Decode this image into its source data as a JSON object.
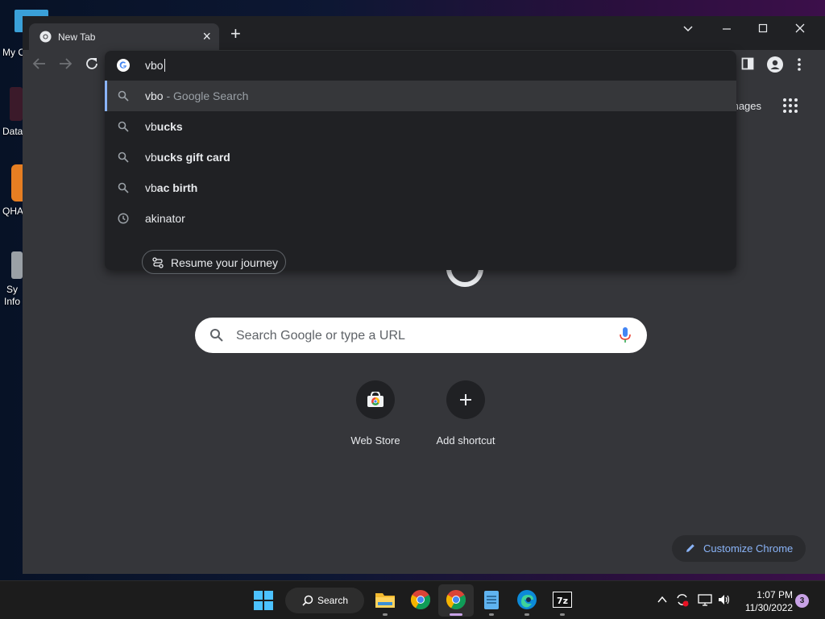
{
  "desktop": {
    "icons": [
      {
        "label": "My C",
        "color": "#3aa0d8"
      },
      {
        "label": "Data",
        "color": "#c0392b"
      },
      {
        "label": "QHA",
        "color": "#e67e22"
      },
      {
        "label": "Sy\nInfo",
        "color": "#9aa0a6"
      }
    ]
  },
  "tab": {
    "title": "New Tab"
  },
  "omnibox": {
    "value": "vbo",
    "suggestions": [
      {
        "prefix": "vbo",
        "bold": "",
        "suffix": " - Google Search",
        "icon": "search-icon"
      },
      {
        "prefix": "vb",
        "bold": "ucks",
        "suffix": "",
        "icon": "search-icon"
      },
      {
        "prefix": "vb",
        "bold": "ucks gift card",
        "suffix": "",
        "icon": "search-icon"
      },
      {
        "prefix": "vb",
        "bold": "ac birth",
        "suffix": "",
        "icon": "search-icon"
      },
      {
        "prefix": "akinator",
        "bold": "",
        "suffix": "",
        "icon": "history-icon"
      }
    ],
    "journey_chip": "Resume your journey"
  },
  "ntp": {
    "images_link": "mages",
    "search_placeholder": "Search Google or type a URL",
    "shortcuts": [
      {
        "label": "Web Store"
      },
      {
        "label": "Add shortcut"
      }
    ],
    "customize": "Customize Chrome"
  },
  "taskbar": {
    "search_label": "Search",
    "time": "1:07 PM",
    "date": "11/30/2022",
    "notification_count": "3"
  },
  "colors": {
    "accent": "#8ab4f8",
    "toolbar": "#35363a",
    "dropdown": "#202124"
  }
}
